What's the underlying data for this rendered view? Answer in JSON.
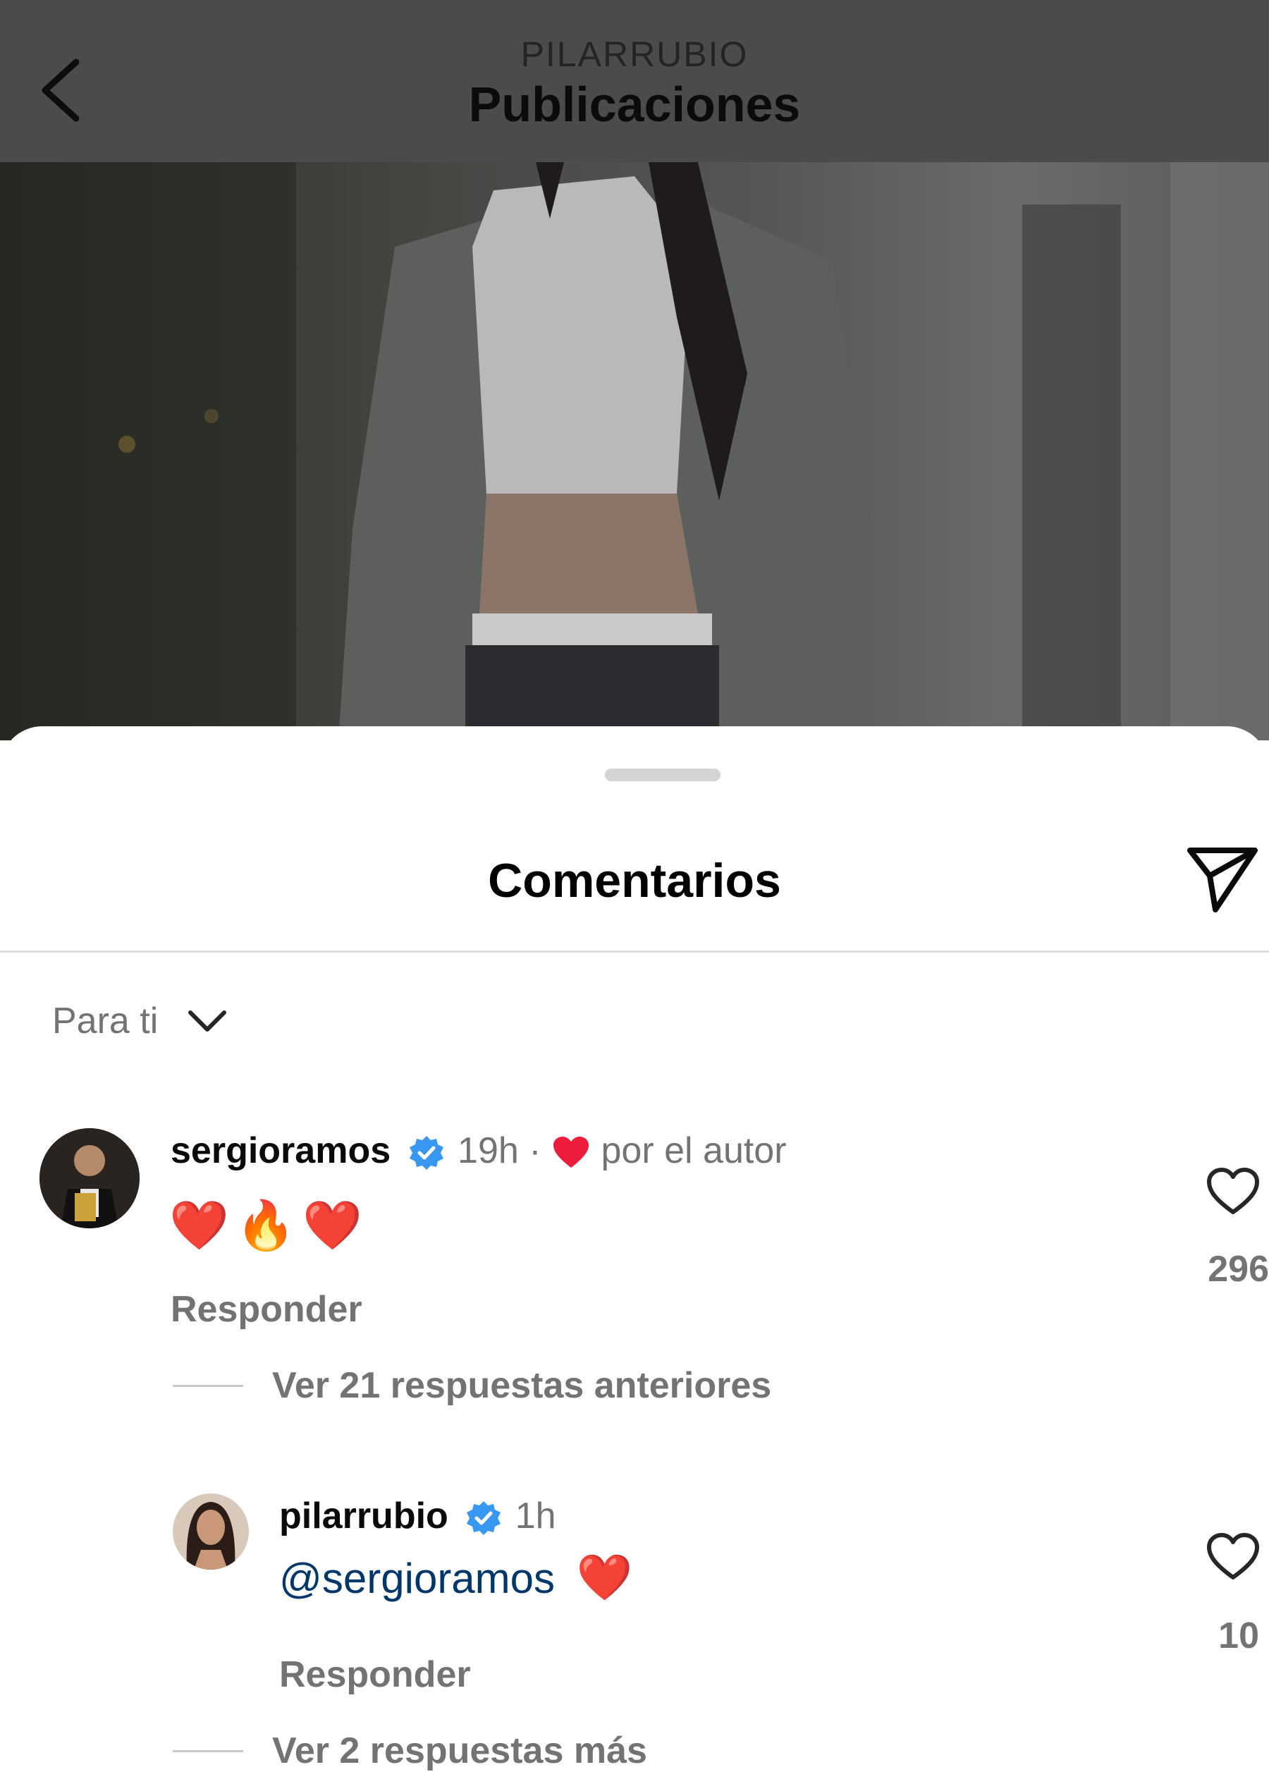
{
  "header": {
    "account": "PILARRUBIO",
    "title": "Publicaciones"
  },
  "sheet": {
    "title": "Comentarios",
    "filter": "Para ti"
  },
  "comments": [
    {
      "username": "sergioramos",
      "time": "19h",
      "separator": "·",
      "liked_by_author": "por el autor",
      "text": "❤️🔥❤️",
      "reply": "Responder",
      "likes": "296",
      "view_replies": "Ver 21 respuestas anteriores"
    },
    {
      "username": "pilarrubio",
      "time": "1h",
      "mention": "@sergioramos",
      "text": "❤️",
      "reply": "Responder",
      "likes": "10",
      "view_replies": "Ver 2 respuestas más"
    }
  ],
  "colors": {
    "verified": "#3897f0",
    "mention": "#00376b",
    "heart": "#ed1c3a",
    "muted": "#737373"
  },
  "icons": [
    "back-icon",
    "share-icon",
    "chevron-down-icon",
    "verified-icon",
    "heart-icon",
    "like-icon"
  ]
}
